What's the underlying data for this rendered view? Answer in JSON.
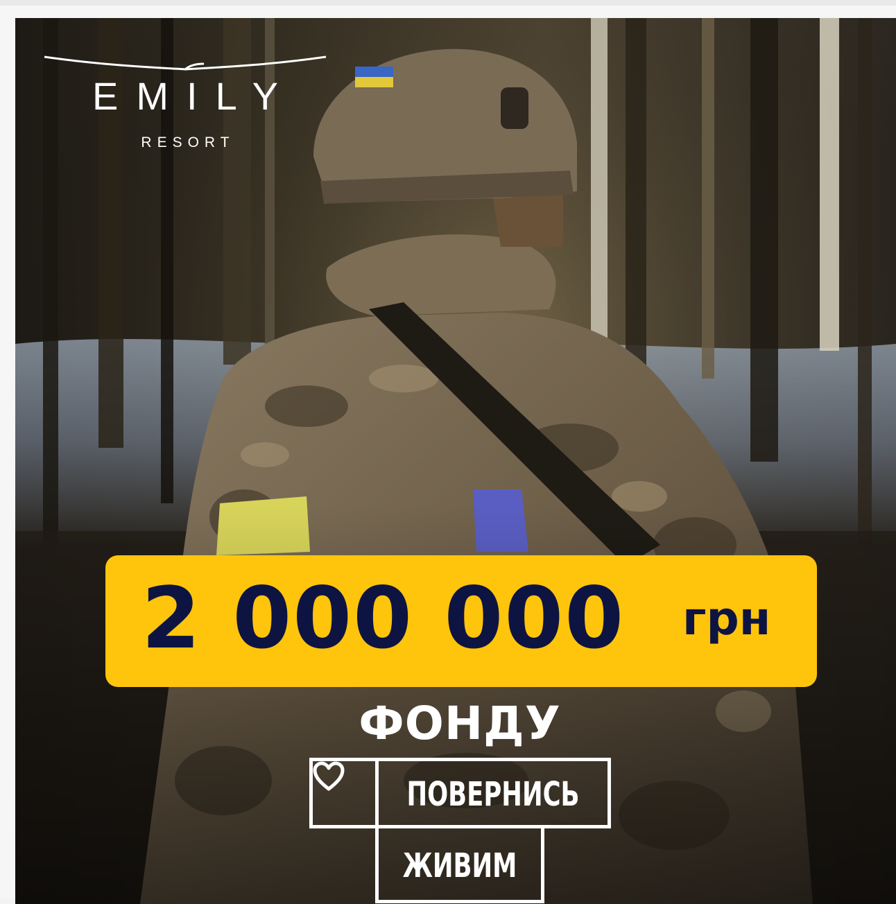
{
  "logo": {
    "word": "EMILY",
    "sub": "RESORT"
  },
  "banner": {
    "amount": "2 000 000",
    "unit": "грн",
    "color": "#ffc50c",
    "text_color": "#0e1442"
  },
  "fund": {
    "label": "ФОНДУ",
    "name_line1": "ПОВЕРНИСЬ",
    "name_line2": "ЖИВИМ",
    "icon": "heart-icon"
  },
  "photo": {
    "subject_icon": "soldier-photo"
  }
}
